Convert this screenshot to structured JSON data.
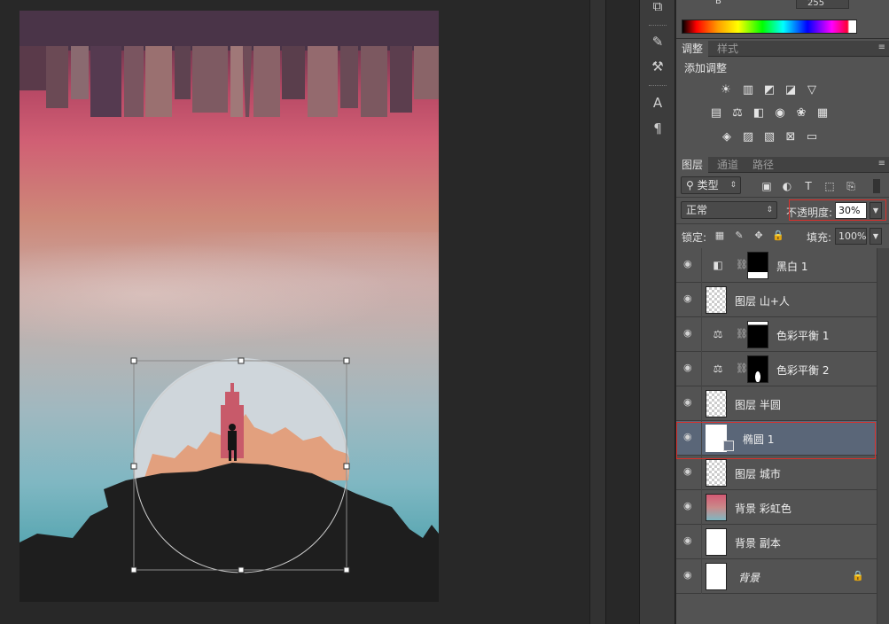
{
  "colors": {
    "selection_red": "#d9302b",
    "panel_bg": "#535353",
    "selected_layer": "#5a6678"
  },
  "color_panel": {
    "channel_label": "B",
    "channel_value": "255"
  },
  "adjust_tabs": [
    {
      "label": "调整"
    },
    {
      "label": "样式"
    }
  ],
  "adjust_title": "添加调整",
  "adjust_icons_row1": [
    "brightness-icon",
    "levels-icon",
    "curves-icon",
    "exposure-icon",
    "vibrance-icon"
  ],
  "adjust_icons_row2": [
    "hue-saturation-icon",
    "color-balance-icon",
    "black-white-icon",
    "photo-filter-icon",
    "channel-mixer-icon",
    "color-lookup-icon"
  ],
  "adjust_icons_row3": [
    "invert-icon",
    "posterize-icon",
    "threshold-icon",
    "selective-color-icon",
    "gradient-map-icon"
  ],
  "layer_tabs": [
    {
      "label": "图层"
    },
    {
      "label": "通道"
    },
    {
      "label": "路径"
    }
  ],
  "filter": {
    "kind": "类型"
  },
  "blend": {
    "mode": "正常",
    "opacity_label": "不透明度:",
    "opacity_value": "30%"
  },
  "lock": {
    "label": "锁定:",
    "fill_label": "填充:",
    "fill_value": "100%"
  },
  "layers": [
    {
      "name": "黑白 1",
      "type": "adjustment",
      "icon": "black-white-icon"
    },
    {
      "name": "图层 山+人",
      "type": "pixel"
    },
    {
      "name": "色彩平衡 1",
      "type": "adjustment",
      "icon": "color-balance-icon"
    },
    {
      "name": "色彩平衡 2",
      "type": "adjustment",
      "icon": "color-balance-icon"
    },
    {
      "name": "图层 半圆",
      "type": "pixel"
    },
    {
      "name": "椭圆 1",
      "type": "shape",
      "selected": true
    },
    {
      "name": "图层 城市",
      "type": "pixel"
    },
    {
      "name": "背景 彩虹色",
      "type": "pixel"
    },
    {
      "name": "背景 副本",
      "type": "pixel"
    },
    {
      "name": "背景",
      "type": "background",
      "locked": true
    }
  ]
}
